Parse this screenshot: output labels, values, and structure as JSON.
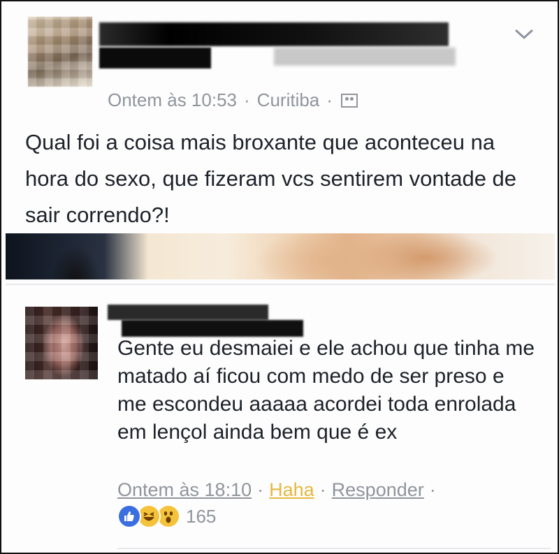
{
  "post": {
    "timestamp": "Ontem às 10:53",
    "separator": "·",
    "location": "Curitiba",
    "audience_icon": "friends-icon",
    "text": "Qual foi a coisa mais broxante que aconteceu na hora do sexo, que fizeram vcs sentirem vontade de sair correndo?!",
    "menu_icon": "chevron-down-icon"
  },
  "comment": {
    "text": "Gente eu desmaiei e ele achou que tinha me matado aí ficou com medo de ser preso e me escondeu aaaaa acordei toda enrolada em lençol ainda bem que é ex",
    "timestamp": "Ontem às 18:10",
    "separator": "·",
    "haha_label": "Haha",
    "reply_label": "Responder",
    "reaction_count": "165",
    "reactions": [
      "like-icon",
      "haha-icon",
      "wow-icon"
    ]
  },
  "colors": {
    "meta_text": "#90949c",
    "body_text": "#1d2129",
    "haha_active": "#e6b83d",
    "like_blue": "#3b6fe0"
  }
}
